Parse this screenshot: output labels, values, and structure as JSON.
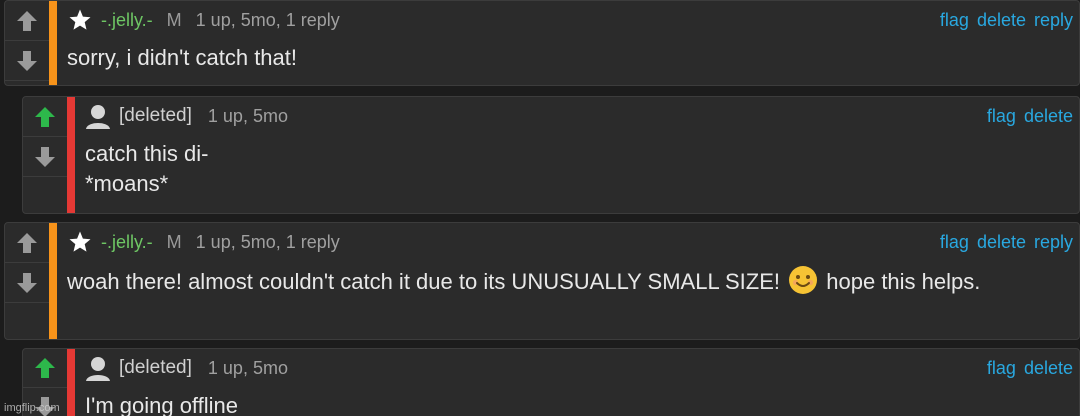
{
  "comments": [
    {
      "user": "-.jelly.-",
      "badge": "M",
      "meta": "1 up, 5mo, 1 reply",
      "actions": [
        "flag",
        "delete",
        "reply"
      ],
      "text": "sorry, i didn't catch that!",
      "icon": "star-icon",
      "upvote_active": false
    },
    {
      "user": "[deleted]",
      "meta": "1 up, 5mo",
      "actions": [
        "flag",
        "delete"
      ],
      "text": "catch this di-\n*moans*",
      "icon": "avatar-icon",
      "upvote_active": true
    },
    {
      "user": "-.jelly.-",
      "badge": "M",
      "meta": "1 up, 5mo, 1 reply",
      "actions": [
        "flag",
        "delete",
        "reply"
      ],
      "text_before": "woah there! almost couldn't catch it due to its UNUSUALLY SMALL SIZE!",
      "text_after": "hope this helps.",
      "emoji": "smiling-face-emoji",
      "icon": "star-icon",
      "upvote_active": false
    },
    {
      "user": "[deleted]",
      "meta": "1 up, 5mo",
      "actions": [
        "flag",
        "delete"
      ],
      "text": "I'm going offline",
      "icon": "avatar-icon",
      "upvote_active": true
    }
  ],
  "watermark": "imgflip.com",
  "colors": {
    "upvote_active": "#2db84b",
    "arrow_inactive": "#9a9a9a",
    "username_green": "#6ec664",
    "action_blue": "#29a8e0",
    "stripe_orange": "#f7931a",
    "stripe_red": "#e53935"
  }
}
